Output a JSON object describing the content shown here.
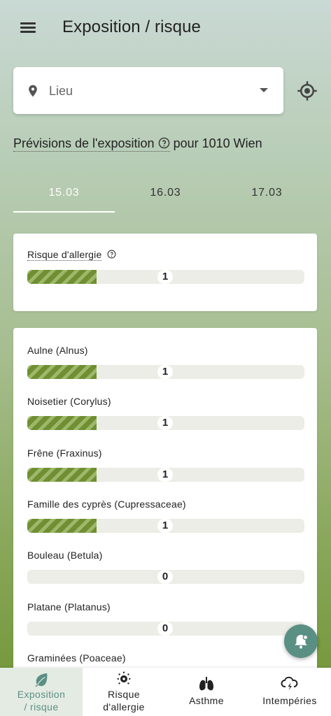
{
  "header": {
    "title": "Exposition / risque"
  },
  "location": {
    "placeholder": "Lieu"
  },
  "forecast": {
    "label": "Prévisions de l'exposition",
    "suffix": " pour 1010 Wien"
  },
  "tabs": [
    {
      "label": "15.03",
      "active": true
    },
    {
      "label": "16.03",
      "active": false
    },
    {
      "label": "17.03",
      "active": false
    }
  ],
  "risk": {
    "label": "Risque d'allergie",
    "value": "1",
    "level": 0.25
  },
  "pollens": [
    {
      "label": "Aulne (Alnus)",
      "value": "1",
      "level": 0.25
    },
    {
      "label": "Noisetier (Corylus)",
      "value": "1",
      "level": 0.25
    },
    {
      "label": "Frêne (Fraxinus)",
      "value": "1",
      "level": 0.25
    },
    {
      "label": "Famille des cyprès (Cupressaceae)",
      "value": "1",
      "level": 0.25
    },
    {
      "label": "Bouleau (Betula)",
      "value": "0",
      "level": 0
    },
    {
      "label": "Platane (Platanus)",
      "value": "0",
      "level": 0
    },
    {
      "label": "Graminées (Poaceae)",
      "value": "",
      "level": 0
    }
  ],
  "nav": [
    {
      "label_line1": "Exposition",
      "label_line2": "/ risque",
      "icon": "leaf-icon",
      "active": true
    },
    {
      "label_line1": "Risque",
      "label_line2": "d'allergie",
      "icon": "virus-gear-icon",
      "active": false
    },
    {
      "label_line1": "Asthme",
      "label_line2": "",
      "icon": "lungs-icon",
      "active": false
    },
    {
      "label_line1": "Intempéries",
      "label_line2": "",
      "icon": "cloud-lightning-icon",
      "active": false
    }
  ],
  "colors": {
    "accent": "#5a8f84",
    "bar_fill": "#6f8f32",
    "bar_track": "#ecede6"
  }
}
